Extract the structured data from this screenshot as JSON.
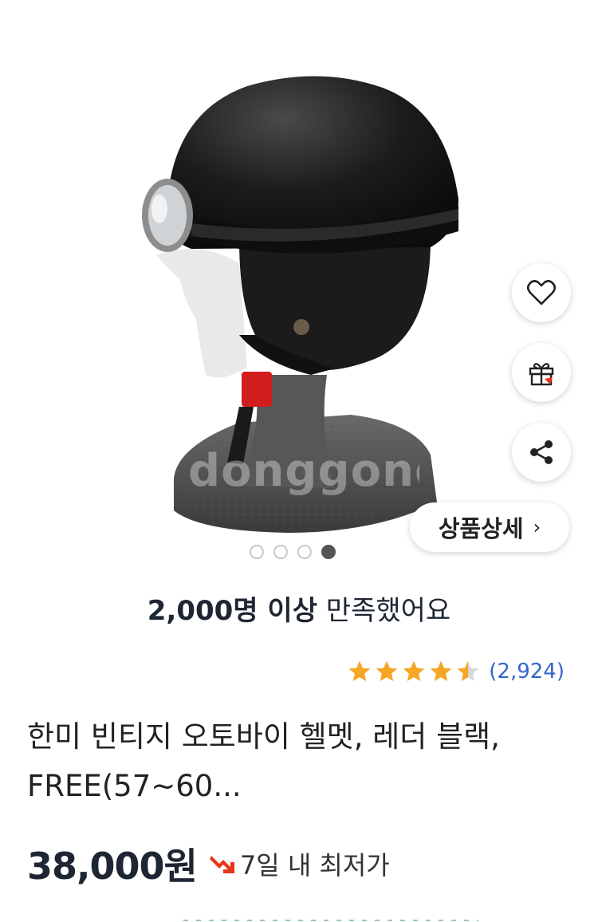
{
  "product": {
    "image_alt": "Helmet product photo",
    "watermark": "donggongan"
  },
  "gallery": {
    "dots": 4,
    "active_dot": 4
  },
  "actions": {
    "wishlist_icon": "heart-icon",
    "gift_icon": "gift-icon",
    "share_icon": "share-icon",
    "detail_label": "상품상세",
    "detail_chevron": "›"
  },
  "satisfaction": {
    "bold": "2,000명 이상",
    "rest": " 만족했어요"
  },
  "rating": {
    "stars": 4.5,
    "count": "(2,924)"
  },
  "title": {
    "line1": "한미 빈티지 오토바이 헬멧, 레더 블랙,",
    "line2": "FREE(57~60..."
  },
  "price": {
    "value": "38,000원",
    "badge_icon": "down-arrow-icon",
    "badge_text": "7일 내 최저가"
  },
  "colors": {
    "star": "#f5a623",
    "review_link": "#3366cc",
    "badge_arrow": "#e8361c"
  }
}
